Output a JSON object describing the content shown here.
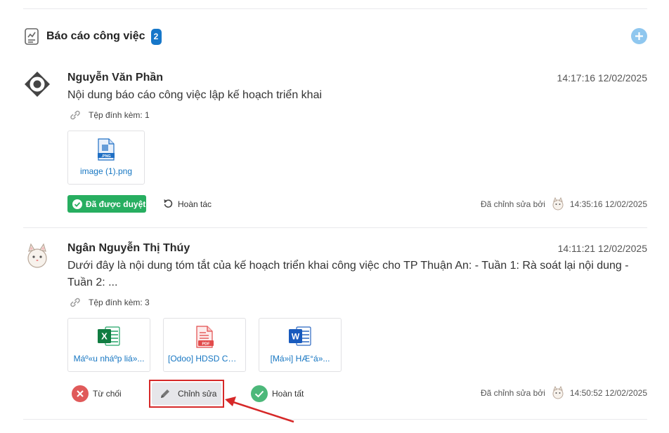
{
  "section": {
    "title": "Báo cáo công việc",
    "count": "2",
    "add_icon": "plus-icon"
  },
  "entries": [
    {
      "author": "Nguyễn Văn Phần",
      "time": "14:17:16 12/02/2025",
      "content": "Nội dung báo cáo công việc lập kế hoạch triển khai",
      "attachments_label": "Tệp đính kèm: 1",
      "files": [
        {
          "name": "image (1).png",
          "icon": "png-file-icon"
        }
      ],
      "status": "Đã được duyệt",
      "undo_label": "Hoàn tác",
      "edited_by_label": "Đã chỉnh sửa bởi",
      "edited_time": "14:35:16 12/02/2025"
    },
    {
      "author": "Ngân Nguyễn Thị Thúy",
      "time": "14:11:21 12/02/2025",
      "content": "Dưới đây là nội dung tóm tắt của kế hoạch triển khai công việc cho TP Thuận An: - Tuần 1: Rà soát lại nội dung - Tuần 2: ...",
      "attachments_label": "Tệp đính kèm: 3",
      "files": [
        {
          "name": "Máº«u nháº­p liá»...",
          "icon": "excel-file-icon"
        },
        {
          "name": "[Odoo] HDSD CH...",
          "icon": "pdf-file-icon"
        },
        {
          "name": "[Má»i] HÆ°á»...",
          "icon": "word-file-icon"
        }
      ],
      "reject_label": "Từ chối",
      "edit_label": "Chỉnh sửa",
      "complete_label": "Hoàn tất",
      "edited_by_label": "Đã chỉnh sửa bởi",
      "edited_time": "14:50:52 12/02/2025"
    }
  ],
  "colors": {
    "accent": "#1677c9",
    "approved": "#27ae60",
    "reject": "#e05a5a",
    "complete": "#4cb87a",
    "highlight": "#d62828"
  }
}
